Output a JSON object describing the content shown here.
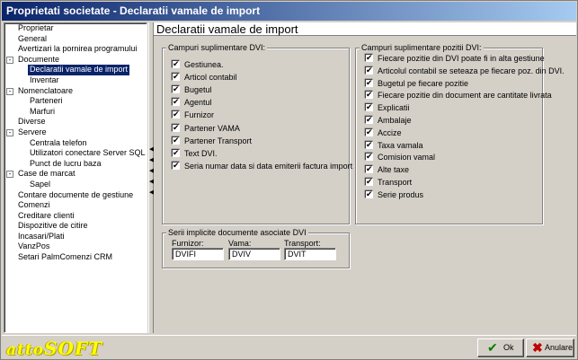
{
  "window": {
    "title": "Proprietati societate - Declaratii vamale de import"
  },
  "tree": {
    "items": [
      {
        "label": "Proprietar",
        "level": 0,
        "expander": "",
        "selected": false
      },
      {
        "label": "General",
        "level": 0,
        "expander": "",
        "selected": false
      },
      {
        "label": "Avertizari la pornirea programului",
        "level": 0,
        "expander": "",
        "selected": false
      },
      {
        "label": "Documente",
        "level": 0,
        "expander": "-",
        "selected": false
      },
      {
        "label": "Declaratii vamale de import",
        "level": 1,
        "expander": "",
        "selected": true
      },
      {
        "label": "Inventar",
        "level": 1,
        "expander": "",
        "selected": false
      },
      {
        "label": "Nomenclatoare",
        "level": 0,
        "expander": "-",
        "selected": false
      },
      {
        "label": "Parteneri",
        "level": 1,
        "expander": "",
        "selected": false
      },
      {
        "label": "Marfuri",
        "level": 1,
        "expander": "",
        "selected": false
      },
      {
        "label": "Diverse",
        "level": 0,
        "expander": "",
        "selected": false
      },
      {
        "label": "Servere",
        "level": 0,
        "expander": "-",
        "selected": false
      },
      {
        "label": "Centrala telefon",
        "level": 1,
        "expander": "",
        "selected": false
      },
      {
        "label": "Utilizatori conectare Server SQL",
        "level": 1,
        "expander": "",
        "selected": false
      },
      {
        "label": "Punct de lucru baza",
        "level": 1,
        "expander": "",
        "selected": false
      },
      {
        "label": "Case de marcat",
        "level": 0,
        "expander": "-",
        "selected": false
      },
      {
        "label": "Sapel",
        "level": 1,
        "expander": "",
        "selected": false
      },
      {
        "label": "Contare documente de gestiune",
        "level": 0,
        "expander": "",
        "selected": false
      },
      {
        "label": "Comenzi",
        "level": 0,
        "expander": "",
        "selected": false
      },
      {
        "label": "Creditare clienti",
        "level": 0,
        "expander": "",
        "selected": false
      },
      {
        "label": "Dispozitive de citire",
        "level": 0,
        "expander": "",
        "selected": false
      },
      {
        "label": "Incasari/Plati",
        "level": 0,
        "expander": "",
        "selected": false
      },
      {
        "label": "VanzPos",
        "level": 0,
        "expander": "",
        "selected": false
      },
      {
        "label": "Setari PalmComenzi CRM",
        "level": 0,
        "expander": "",
        "selected": false
      }
    ]
  },
  "panel": {
    "title": "Declaratii vamale de import",
    "dvi_fields": {
      "title": "Campuri suplimentare DVI:",
      "items": [
        {
          "label": "Gestiunea.",
          "checked": true
        },
        {
          "label": "Articol contabil",
          "checked": true
        },
        {
          "label": "Bugetul",
          "checked": true
        },
        {
          "label": "Agentul",
          "checked": true
        },
        {
          "label": "Furnizor",
          "checked": true
        },
        {
          "label": "Partener VAMA",
          "checked": true
        },
        {
          "label": "Partener Transport",
          "checked": true
        },
        {
          "label": "Text DVI.",
          "checked": true
        },
        {
          "label": "Seria numar data si data emiterii factura import",
          "checked": true
        }
      ]
    },
    "position_fields": {
      "title": "Campuri suplimentare pozitii DVI:",
      "items": [
        {
          "label": "Fiecare pozitie din DVI poate fi in alta gestiune",
          "checked": true
        },
        {
          "label": "Articolul contabil se seteaza pe fiecare poz. din DVI.",
          "checked": true
        },
        {
          "label": "Bugetul pe fiecare pozitie",
          "checked": true
        },
        {
          "label": "Fiecare pozitie din document are cantitate livrata",
          "checked": true
        },
        {
          "label": "Explicatii",
          "checked": true
        },
        {
          "label": "Ambalaje",
          "checked": true
        },
        {
          "label": "Accize",
          "checked": true
        },
        {
          "label": "Taxa vamala",
          "checked": true
        },
        {
          "label": "Comision vamal",
          "checked": true
        },
        {
          "label": "Alte taxe",
          "checked": true
        },
        {
          "label": "Transport",
          "checked": true
        },
        {
          "label": "Serie produs",
          "checked": true
        }
      ]
    },
    "series": {
      "title": "Serii implicite documente asociate DVI",
      "fields": [
        {
          "label": "Furnizor:",
          "value": "DVIFI"
        },
        {
          "label": "Vama:",
          "value": "DVIV"
        },
        {
          "label": "Transport:",
          "value": "DVIT"
        }
      ]
    }
  },
  "footer": {
    "logo_prefix": "atto",
    "logo_main": "SOFT",
    "ok_label": "Ok",
    "cancel_label": "Anulare",
    "ok_icon": "checkmark-icon",
    "cancel_icon": "x-icon"
  },
  "colors": {
    "title_start": "#0a246a",
    "title_end": "#a6caf0",
    "selection": "#0a246a",
    "logo": "#ffff00"
  }
}
